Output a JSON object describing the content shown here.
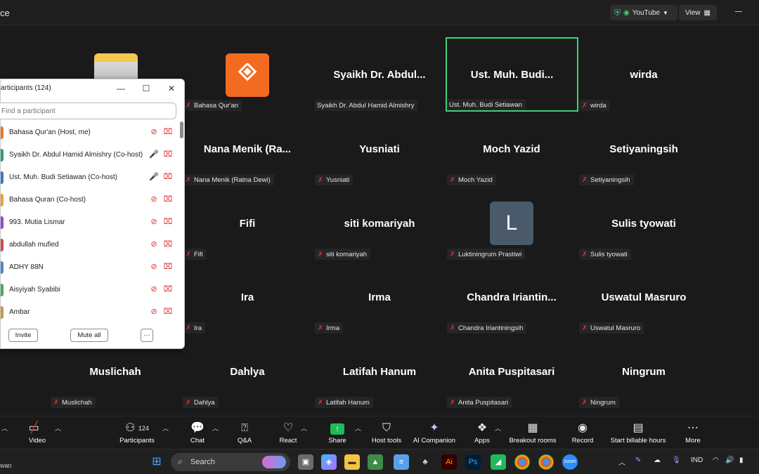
{
  "window": {
    "title_fragment": "ce"
  },
  "titlebar": {
    "youtube_label": "YouTube",
    "view_label": "View"
  },
  "tiles": [
    {
      "name": "",
      "label": ""
    },
    {
      "name": "",
      "label": "Bahasa Qur'an"
    },
    {
      "name": "Syaikh Dr. Abdul...",
      "label": "Syaikh Dr. Abdul Hamid Almishry"
    },
    {
      "name": "Ust. Muh. Budi...",
      "label": "Ust. Muh. Budi Setiawan"
    },
    {
      "name": "wirda",
      "label": "wirda"
    },
    {
      "name": "Nana Menik (Ra...",
      "label": "Nana Menik (Ratna Dewi)"
    },
    {
      "name": "Yusniati",
      "label": "Yusniati"
    },
    {
      "name": "Moch Yazid",
      "label": "Moch Yazid"
    },
    {
      "name": "Setiyaningsih",
      "label": "Setiyaningsih"
    },
    {
      "name": "Fifi",
      "label": "Fifi"
    },
    {
      "name": "siti komariyah",
      "label": "siti komariyah"
    },
    {
      "name": "",
      "label": "Luktiningrum Prastiwi",
      "avatar_letter": "L"
    },
    {
      "name": "Sulis tyowati",
      "label": "Sulis tyowati"
    },
    {
      "name": "Ira",
      "label": "Ira"
    },
    {
      "name": "Irma",
      "label": "Irma"
    },
    {
      "name": "Chandra  Iriantin...",
      "label": "Chandra Iriantiningsih"
    },
    {
      "name": "Uswatul Masruro",
      "label": "Uswatul Masruro"
    },
    {
      "name": "Muslichah",
      "label": "Muslichah"
    },
    {
      "name": "Dahlya",
      "label": "Dahlya"
    },
    {
      "name": "Latifah Hanum",
      "label": "Latifah Hanum"
    },
    {
      "name": "Anita Puspitasari",
      "label": "Anita Puspitasari"
    },
    {
      "name": "Ningrum",
      "label": "Ningrum"
    }
  ],
  "participants_panel": {
    "title": "articipants (124)",
    "search_placeholder": "Find a participant",
    "participants": [
      {
        "name": "Bahasa Qur'an (Host, me)",
        "muted": true,
        "color": "#e8772e"
      },
      {
        "name": "Syaikh Dr. Abdul Hamid Almishry (Co-host)",
        "muted": false,
        "color": "#2f9e6e"
      },
      {
        "name": "Ust. Muh. Budi Setiawan (Co-host)",
        "muted": false,
        "color": "#3c78c8"
      },
      {
        "name": "Bahasa Quran (Co-host)",
        "muted": true,
        "color": "#e8a23a"
      },
      {
        "name": "993. Mutia Lismar",
        "muted": true,
        "color": "#8a4cc8"
      },
      {
        "name": "abdullah mufied",
        "muted": true,
        "color": "#c84c4c"
      },
      {
        "name": "ADHY 88N",
        "muted": true,
        "color": "#4c8ac8"
      },
      {
        "name": "Aisyiyah Syabibi",
        "muted": true,
        "color": "#4ca86a"
      },
      {
        "name": "Ambar",
        "muted": true,
        "color": "#c8964c"
      }
    ],
    "invite_label": "Invite",
    "mute_all_label": "Mute all",
    "more_label": "···"
  },
  "toolbar": {
    "video": "Video",
    "participants": "Participants",
    "participants_count": "124",
    "chat": "Chat",
    "qa": "Q&A",
    "react": "React",
    "share": "Share",
    "host_tools": "Host tools",
    "ai_companion": "AI Companion",
    "apps": "Apps",
    "breakout_rooms": "Breakout rooms",
    "record": "Record",
    "billable": "Start billable hours",
    "more": "More"
  },
  "taskbar": {
    "search_label": "Search",
    "left_fragment": "wan",
    "language": "IND"
  },
  "colors": {
    "active_speaker": "#3fd07a",
    "muted_red": "#e02d2d",
    "share_green": "#1fba5c",
    "brand_orange": "#f26b21"
  }
}
